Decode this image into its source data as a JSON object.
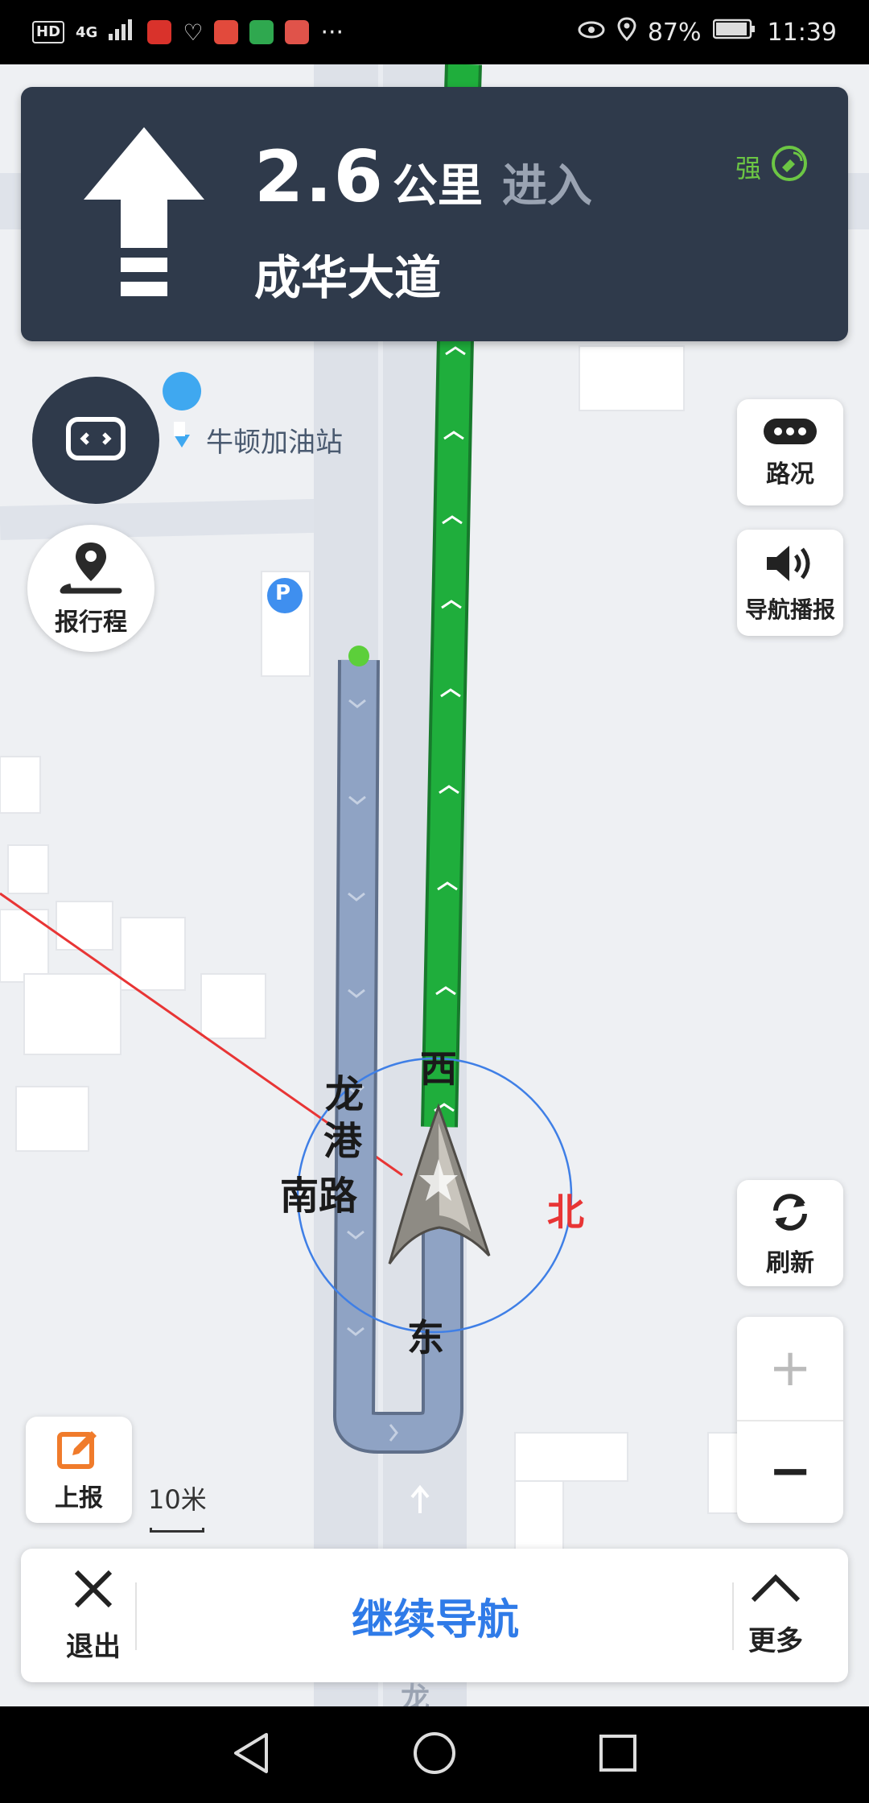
{
  "status_bar": {
    "hd_label": "HD",
    "network_label": "4G",
    "battery": "87%",
    "time": "11:39",
    "more_indicator": "···"
  },
  "nav_banner": {
    "distance_value": "2.6",
    "distance_unit": "公里",
    "action": "进入",
    "road_name": "成华大道",
    "gps_label": "强",
    "direction_icon": "straight-arrow-icon"
  },
  "map": {
    "poi_gas_station": "牛顿加油站",
    "parking_label": "P",
    "road_label_line1": "龙",
    "road_label_line2": "港",
    "road_label_line3": "南路",
    "compass_west": "西",
    "compass_north": "北",
    "compass_east": "东",
    "road_bottom_label": "龙路",
    "scale_label": "10米"
  },
  "controls": {
    "report_trip_label": "报行程",
    "traffic_label": "路况",
    "voice_label": "导航播报",
    "refresh_label": "刷新",
    "zoom_in": "+",
    "zoom_out": "−",
    "report_label": "上报"
  },
  "bottom_panel": {
    "exit_label": "退出",
    "continue_label": "继续导航",
    "more_label": "更多"
  },
  "colors": {
    "banner_bg": "#2f3a4b",
    "route_green": "#1fae3c",
    "route_grey_blue": "#8fa3c4",
    "accent_blue": "#2f7be8",
    "north_red": "#e83535",
    "gps_green": "#6cc644"
  }
}
